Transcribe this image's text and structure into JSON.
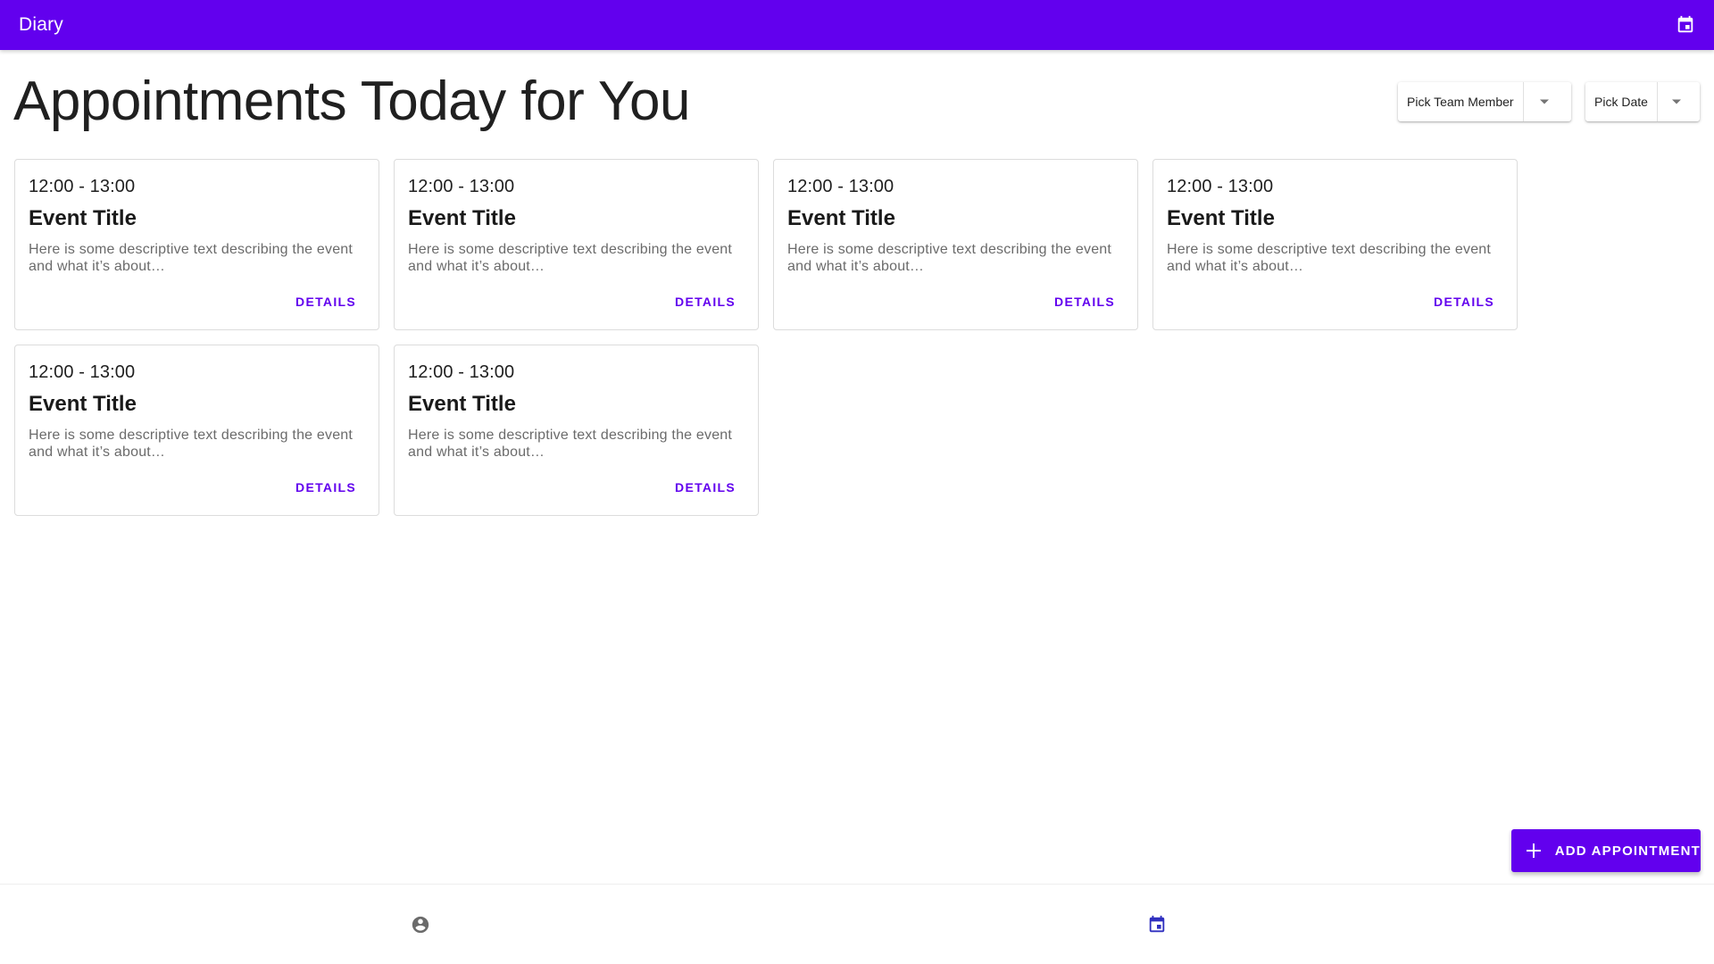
{
  "app_bar": {
    "title": "Diary",
    "action_icon": "calendar-icon",
    "background": "#6200ee"
  },
  "page_title": "Appointments Today for You",
  "filters": {
    "team_member": {
      "label": "Pick Team Member",
      "icon": "dropdown-arrow-icon"
    },
    "date": {
      "label": "Pick Date",
      "icon": "dropdown-arrow-icon"
    }
  },
  "appointments": [
    {
      "time": "12:00 - 13:00",
      "title": "Event Title",
      "description": "Here is some descriptive text describing the event and what it’s about…",
      "action": "DETAILS"
    },
    {
      "time": "12:00 - 13:00",
      "title": "Event Title",
      "description": "Here is some descriptive text describing the event and what it’s about…",
      "action": "DETAILS"
    },
    {
      "time": "12:00 - 13:00",
      "title": "Event Title",
      "description": "Here is some descriptive text describing the event and what it’s about…",
      "action": "DETAILS"
    },
    {
      "time": "12:00 - 13:00",
      "title": "Event Title",
      "description": "Here is some descriptive text describing the event and what it’s about…",
      "action": "DETAILS"
    },
    {
      "time": "12:00 - 13:00",
      "title": "Event Title",
      "description": "Here is some descriptive text describing the event and what it’s about…",
      "action": "DETAILS"
    },
    {
      "time": "12:00 - 13:00",
      "title": "Event Title",
      "description": "Here is some descriptive text describing the event and what it’s about…",
      "action": "DETAILS"
    }
  ],
  "fab": {
    "label": "ADD APPOINTMENT",
    "icon": "plus-icon"
  },
  "bottom_nav": {
    "items": [
      {
        "icon": "account-circle-icon",
        "active": false,
        "color": "#6b6b6b"
      },
      {
        "icon": "calendar-icon",
        "active": true,
        "color": "#2f2fbf"
      }
    ]
  },
  "colors": {
    "accent": "#6200ee"
  }
}
